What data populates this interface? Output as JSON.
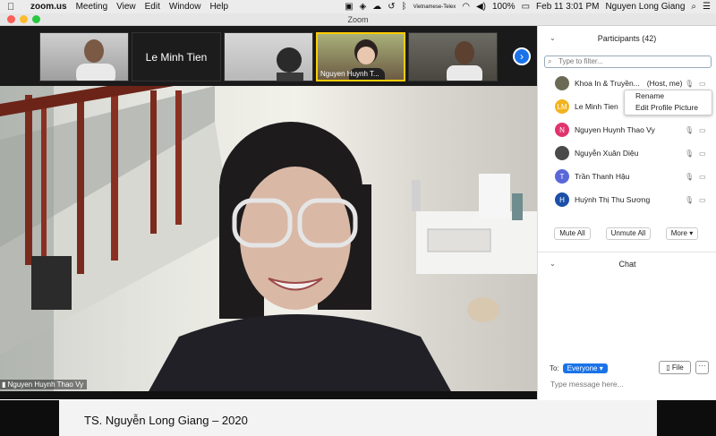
{
  "menubar": {
    "app": "zoom.us",
    "items": [
      "Meeting",
      "View",
      "Edit",
      "Window",
      "Help"
    ],
    "input_method": "Vietnamese-Telex",
    "battery": "100%",
    "datetime": "Feb 11  3:01 PM",
    "user": "Nguyen Long Giang"
  },
  "window": {
    "title": "Zoom"
  },
  "thumbnails": [
    {
      "name": ""
    },
    {
      "name": "Le Minh Tien"
    },
    {
      "name": ""
    },
    {
      "name": "Nguyen Huynh T..."
    },
    {
      "name": ""
    }
  ],
  "active_speaker": {
    "name": "Nguyen Huynh Thao Vy"
  },
  "slide": {
    "title": "TS. Nguyễn Long Giang – 2020"
  },
  "participants": {
    "header": "Participants (42)",
    "filter_placeholder": "Type to filter...",
    "list": [
      {
        "initials": "",
        "name": "Khoa In & Truyền...",
        "tag": "(Host, me)",
        "color": "#6b6b55"
      },
      {
        "initials": "LM",
        "name": "Le Minh Tien",
        "tag": "",
        "color": "#f2b41e"
      },
      {
        "initials": "N",
        "name": "Nguyen Huynh Thao Vy",
        "tag": "",
        "color": "#e0346f"
      },
      {
        "initials": "",
        "name": "Nguyễn Xuân Diệu",
        "tag": "",
        "color": "#4a4a4a"
      },
      {
        "initials": "T",
        "name": "Trần Thanh Hậu",
        "tag": "",
        "color": "#5a67d8"
      },
      {
        "initials": "H",
        "name": "Huỳnh Thị Thu Sương",
        "tag": "",
        "color": "#1b4fa8"
      }
    ],
    "buttons": {
      "mute_all": "Mute All",
      "unmute_all": "Unmute All",
      "more": "More ▾"
    }
  },
  "context_menu": [
    "Rename",
    "Edit Profile Picture"
  ],
  "chat": {
    "header": "Chat",
    "to_label": "To:",
    "to_value": "Everyone ▾",
    "file_label": "File",
    "more_label": "···",
    "placeholder": "Type message here..."
  }
}
